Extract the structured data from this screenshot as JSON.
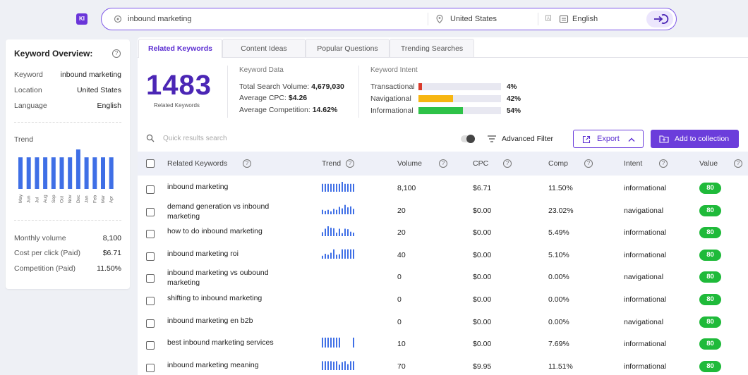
{
  "app": {
    "logo_text": "KI"
  },
  "search": {
    "query": "inbound marketing",
    "location": "United States",
    "language": "English"
  },
  "overview": {
    "title": "Keyword Overview:",
    "rows": [
      {
        "label": "Keyword",
        "value": "inbound marketing"
      },
      {
        "label": "Location",
        "value": "United States"
      },
      {
        "label": "Language",
        "value": "English"
      }
    ],
    "trend_label": "Trend",
    "trend_months": [
      "May",
      "Jun",
      "Jul",
      "Aug",
      "Sep",
      "Oct",
      "Nov",
      "Dec",
      "Jan",
      "Feb",
      "Mar",
      "Apr"
    ],
    "trend_values": [
      80,
      80,
      80,
      80,
      80,
      80,
      80,
      100,
      80,
      80,
      80,
      80
    ],
    "metrics": [
      {
        "label": "Monthly volume",
        "value": "8,100"
      },
      {
        "label": "Cost per click (Paid)",
        "value": "$6.71"
      },
      {
        "label": "Competition (Paid)",
        "value": "11.50%"
      }
    ]
  },
  "tabs": [
    "Related Keywords",
    "Content Ideas",
    "Popular Questions",
    "Trending Searches"
  ],
  "summary": {
    "count": "1483",
    "count_label": "Related Keywords",
    "keyword_data_title": "Keyword Data",
    "total_volume_label": "Total Search Volume:",
    "total_volume": "4,679,030",
    "avg_cpc_label": "Average CPC:",
    "avg_cpc": "$4.26",
    "avg_comp_label": "Average Competition:",
    "avg_comp": "14.62%",
    "intent_title": "Keyword Intent",
    "intents": [
      {
        "label": "Transactional",
        "pct": "4%",
        "value": 4,
        "color": "#d93a2b"
      },
      {
        "label": "Navigational",
        "pct": "42%",
        "value": 42,
        "color": "#f7b611"
      },
      {
        "label": "Informational",
        "pct": "54%",
        "value": 54,
        "color": "#2ec248"
      }
    ]
  },
  "toolbar": {
    "search_placeholder": "Quick results search",
    "advanced_filter": "Advanced Filter",
    "export": "Export",
    "add_to_collection": "Add to collection"
  },
  "table": {
    "columns": [
      "Related Keywords",
      "Trend",
      "Volume",
      "CPC",
      "Comp",
      "Intent",
      "Value"
    ],
    "rows": [
      {
        "keyword": "inbound marketing",
        "trend": [
          80,
          80,
          80,
          80,
          80,
          80,
          80,
          100,
          80,
          80,
          80,
          80
        ],
        "volume": "8,100",
        "cpc": "$6.71",
        "comp": "11.50%",
        "intent": "informational",
        "value": "80"
      },
      {
        "keyword": "demand generation vs inbound marketing",
        "trend": [
          45,
          35,
          45,
          30,
          55,
          45,
          75,
          60,
          95,
          70,
          80,
          55
        ],
        "volume": "20",
        "cpc": "$0.00",
        "comp": "23.02%",
        "intent": "navigational",
        "value": "80"
      },
      {
        "keyword": "how to do inbound marketing",
        "trend": [
          40,
          75,
          100,
          85,
          80,
          35,
          75,
          30,
          75,
          70,
          45,
          35
        ],
        "volume": "20",
        "cpc": "$0.00",
        "comp": "5.49%",
        "intent": "informational",
        "value": "80"
      },
      {
        "keyword": "inbound marketing roi",
        "trend": [
          30,
          50,
          40,
          60,
          95,
          40,
          45,
          95,
          95,
          95,
          95,
          95
        ],
        "volume": "40",
        "cpc": "$0.00",
        "comp": "5.10%",
        "intent": "informational",
        "value": "80"
      },
      {
        "keyword": "inbound marketing vs oubound marketing",
        "trend": [],
        "volume": "0",
        "cpc": "$0.00",
        "comp": "0.00%",
        "intent": "navigational",
        "value": "80"
      },
      {
        "keyword": "shifting to inbound marketing",
        "trend": [],
        "volume": "0",
        "cpc": "$0.00",
        "comp": "0.00%",
        "intent": "informational",
        "value": "80"
      },
      {
        "keyword": "inbound marketing en b2b",
        "trend": [],
        "volume": "0",
        "cpc": "$0.00",
        "comp": "0.00%",
        "intent": "navigational",
        "value": "80"
      },
      {
        "keyword": "best inbound marketing services",
        "trend": [
          100,
          100,
          100,
          100,
          100,
          100,
          100,
          0,
          0,
          0,
          0,
          100
        ],
        "volume": "10",
        "cpc": "$0.00",
        "comp": "7.69%",
        "intent": "informational",
        "value": "80"
      },
      {
        "keyword": "inbound marketing meaning",
        "trend": [
          90,
          90,
          90,
          90,
          85,
          90,
          55,
          80,
          90,
          60,
          90,
          90
        ],
        "volume": "70",
        "cpc": "$9.95",
        "comp": "11.51%",
        "intent": "informational",
        "value": "80"
      }
    ]
  },
  "colors": {
    "accent": "#6b3ddb",
    "trend_bar": "#3f6fe6",
    "value_badge": "#1fba3a"
  }
}
